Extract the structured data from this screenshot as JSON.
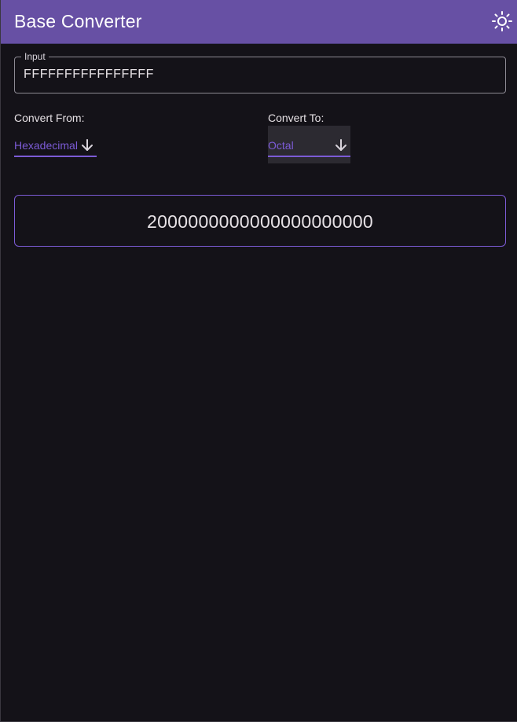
{
  "header": {
    "title": "Base Converter",
    "theme_toggle_icon": "sun-icon"
  },
  "input": {
    "label": "Input",
    "value": "FFFFFFFFFFFFFFFF"
  },
  "convert_from": {
    "label": "Convert From:",
    "selected": "Hexadecimal",
    "icon": "arrow-down-icon"
  },
  "convert_to": {
    "label": "Convert To:",
    "selected": "Octal",
    "icon": "arrow-down-icon"
  },
  "result": {
    "value": "2000000000000000000000"
  },
  "colors": {
    "appbar": "#6750a4",
    "accent": "#7c5bd6",
    "background": "#141218",
    "text": "#e6e1e5"
  }
}
